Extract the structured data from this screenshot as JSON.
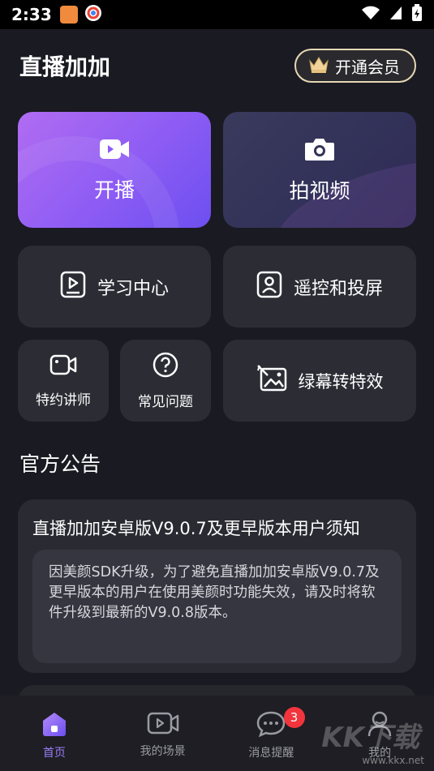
{
  "status_bar": {
    "time": "2:33"
  },
  "header": {
    "title": "直播加加",
    "vip_label": "开通会员"
  },
  "cards": {
    "live": {
      "label": "开播",
      "icon": "video-camera-icon"
    },
    "video": {
      "label": "拍视频",
      "icon": "camera-icon"
    },
    "study": {
      "label": "学习中心",
      "icon": "play-book-icon"
    },
    "remote": {
      "label": "遥控和投屏",
      "icon": "remote-screen-icon"
    },
    "lecturer": {
      "label": "特约讲师",
      "icon": "video-icon"
    },
    "faq": {
      "label": "常见问题",
      "icon": "question-icon"
    },
    "green": {
      "label": "绿幕转特效",
      "icon": "image-edit-icon"
    }
  },
  "section": {
    "title": "官方公告"
  },
  "notice": {
    "title": "直播加加安卓版V9.0.7及更早版本用户须知",
    "body": "因美颜SDK升级，为了避免直播加加安卓版V9.0.7及更早版本的用户在使用美颜时功能失效，请及时将软件升级到最新的V9.0.8版本。"
  },
  "tabs": [
    {
      "label": "首页",
      "icon": "home-icon",
      "active": true
    },
    {
      "label": "我的场景",
      "icon": "video-scene-icon"
    },
    {
      "label": "消息提醒",
      "icon": "message-icon",
      "badge": "3"
    },
    {
      "label": "我的",
      "icon": "user-icon"
    }
  ],
  "watermark": {
    "text": "www.kkx.net",
    "logo": "KK下载"
  },
  "colors": {
    "accent": "#9b7cf7",
    "background": "#1a1a22",
    "card": "#2c2c35",
    "badge": "#f2343d"
  }
}
